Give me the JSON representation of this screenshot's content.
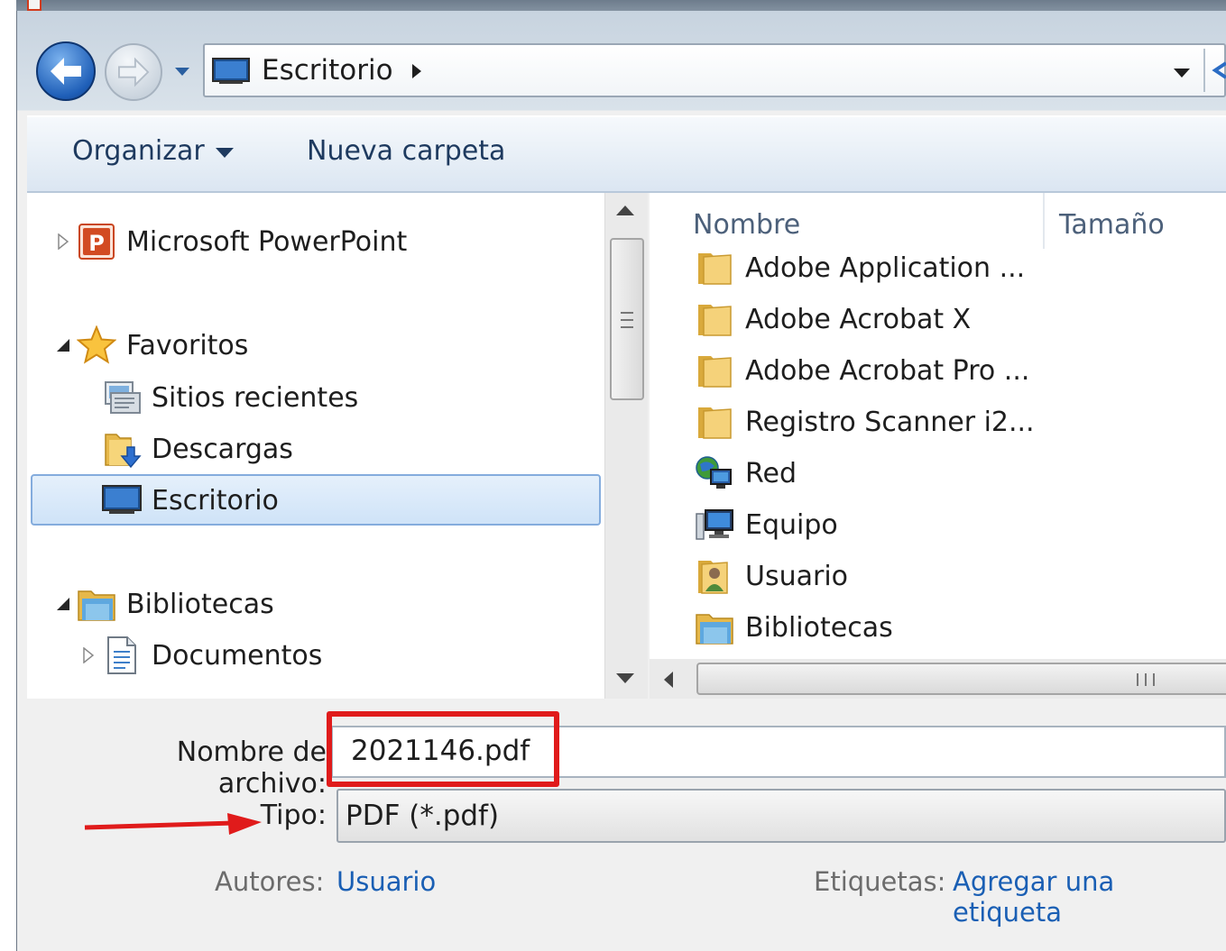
{
  "address": {
    "location": "Escritorio"
  },
  "toolbar": {
    "organize_label": "Organizar",
    "new_folder_label": "Nueva carpeta"
  },
  "nav": {
    "items": [
      {
        "label": "Microsoft PowerPoint",
        "icon": "powerpoint-icon",
        "expander": "collapsed"
      },
      {
        "label": "Favoritos",
        "icon": "star-icon",
        "expander": "expanded"
      },
      {
        "label": "Sitios recientes",
        "icon": "recent-places-icon",
        "expander": "none"
      },
      {
        "label": "Descargas",
        "icon": "downloads-folder-icon",
        "expander": "none"
      },
      {
        "label": "Escritorio",
        "icon": "desktop-icon",
        "expander": "none",
        "selected": true
      },
      {
        "label": "Bibliotecas",
        "icon": "libraries-icon",
        "expander": "expanded"
      },
      {
        "label": "Documentos",
        "icon": "document-icon",
        "expander": "collapsed"
      }
    ]
  },
  "files": {
    "columns": [
      "Nombre",
      "Tamaño"
    ],
    "items": [
      {
        "label": "Adobe Application ...",
        "icon": "folder-icon"
      },
      {
        "label": "Adobe Acrobat X",
        "icon": "folder-icon"
      },
      {
        "label": "Adobe Acrobat Pro ...",
        "icon": "folder-icon"
      },
      {
        "label": "Registro Scanner i2...",
        "icon": "folder-icon"
      },
      {
        "label": "Red",
        "icon": "network-icon"
      },
      {
        "label": "Equipo",
        "icon": "computer-icon"
      },
      {
        "label": "Usuario",
        "icon": "user-folder-icon"
      },
      {
        "label": "Bibliotecas",
        "icon": "libraries-icon"
      }
    ]
  },
  "form": {
    "filename_label": "Nombre de archivo:",
    "filename_value": "2021146.pdf",
    "type_label": "Tipo:",
    "type_value": "PDF (*.pdf)",
    "authors_label": "Autores:",
    "authors_value": "Usuario",
    "tags_label": "Etiquetas:",
    "tags_value": "Agregar una etiqueta"
  },
  "colors": {
    "highlight": "#e01b1b",
    "link": "#1a5fb4",
    "selection": "#cfe3f8"
  }
}
